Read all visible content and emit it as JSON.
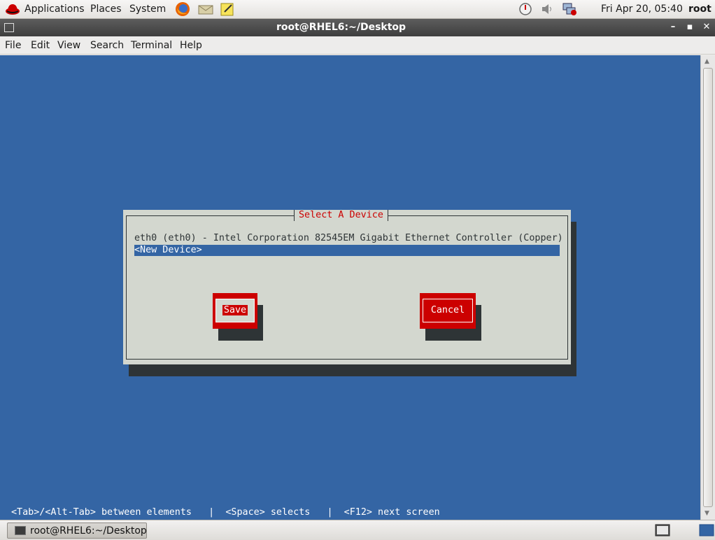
{
  "top_panel": {
    "menus": [
      "Applications",
      "Places",
      "System"
    ],
    "clock": "Fri Apr 20, 05:40",
    "user": "root"
  },
  "window": {
    "title": "root@RHEL6:~/Desktop",
    "menubar": [
      "File",
      "Edit",
      "View",
      "Search",
      "Terminal",
      "Help"
    ]
  },
  "dialog": {
    "title": "Select A Device",
    "devices": [
      "eth0 (eth0) - Intel Corporation 82545EM Gigabit Ethernet Controller (Copper)",
      "<New Device>"
    ],
    "selected_index": 1,
    "save_label": "Save",
    "cancel_label": "Cancel"
  },
  "help_line": "<Tab>/<Alt-Tab> between elements   |  <Space> selects   |  <F12> next screen",
  "taskbar": {
    "task_label": "root@RHEL6:~/Desktop"
  },
  "colors": {
    "terminal_bg": "#3465a4",
    "dialog_bg": "#d3d7cf",
    "accent_red": "#cc0000"
  }
}
